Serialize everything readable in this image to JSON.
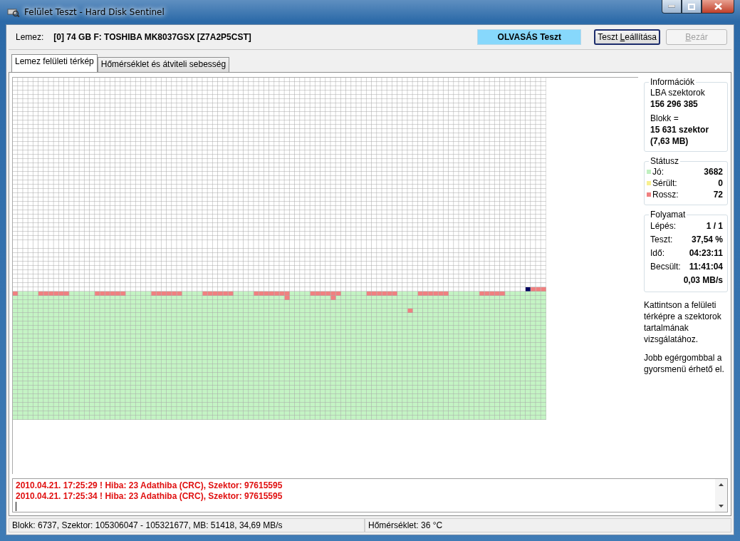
{
  "window": {
    "title": "Felület Teszt - Hard Disk Sentinel"
  },
  "disk": {
    "label": "Lemez:",
    "value": "[0] 74 GB F: TOSHIBA MK8037GSX [Z7A2P5CST]"
  },
  "test_mode": "OLVASÁS Teszt",
  "buttons": [
    {
      "before": "Teszt ",
      "access_key": "L",
      "after": "eállítása",
      "disabled": false
    },
    {
      "access_key": "B",
      "after": "ezár",
      "disabled": true
    }
  ],
  "tabs": [
    {
      "label": "Lemez felületi térkép",
      "selected": true
    },
    {
      "label": "Hőmérséklet és átviteli sebesség",
      "selected": false
    }
  ],
  "info": {
    "title": "Információk",
    "lines": [
      {
        "text": "LBA szektorok",
        "bold": false
      },
      {
        "text": "156 296 385",
        "bold": true
      },
      {
        "text": "Blokk =",
        "bold": false
      },
      {
        "text": "15 631 szektor",
        "bold": true
      },
      {
        "text": "(7,63 MB)",
        "bold": true
      }
    ]
  },
  "status": {
    "title": "Státusz",
    "items": [
      {
        "label": "Jó:",
        "value": "3682",
        "color": "#c0f0c0"
      },
      {
        "label": "Sérült:",
        "value": "0",
        "color": "#f8f090"
      },
      {
        "label": "Rossz:",
        "value": "72",
        "color": "#f08080"
      }
    ]
  },
  "progress": {
    "title": "Folyamat",
    "rows": [
      {
        "label": "Lépés:",
        "value": "1 / 1"
      },
      {
        "label": "Teszt:",
        "value": "37,54 %"
      },
      {
        "label": "Idő:",
        "value": "04:23:11"
      },
      {
        "label": "Becsült:",
        "value": "11:41:04"
      },
      {
        "value": "0,03 MB/s"
      }
    ]
  },
  "help": [
    "Kattintson a felületi térképre a szektorok tartalmának vizsgálatához.",
    "Jobb egérgombbal a gyorsmenü érhető el."
  ],
  "log": [
    "2010.04.21. 17:25:29 ! Hiba: 23 Adathiba (CRC), Szektor: 97615595",
    "2010.04.21. 17:25:34 ! Hiba: 23 Adathiba (CRC), Szektor: 97615595"
  ],
  "status_bar": [
    "Blokk: 6737, Szektor: 105306047 - 105321677, MB: 51418, 34,69 MB/s",
    "Hőmérséklet: 36  °C"
  ]
}
